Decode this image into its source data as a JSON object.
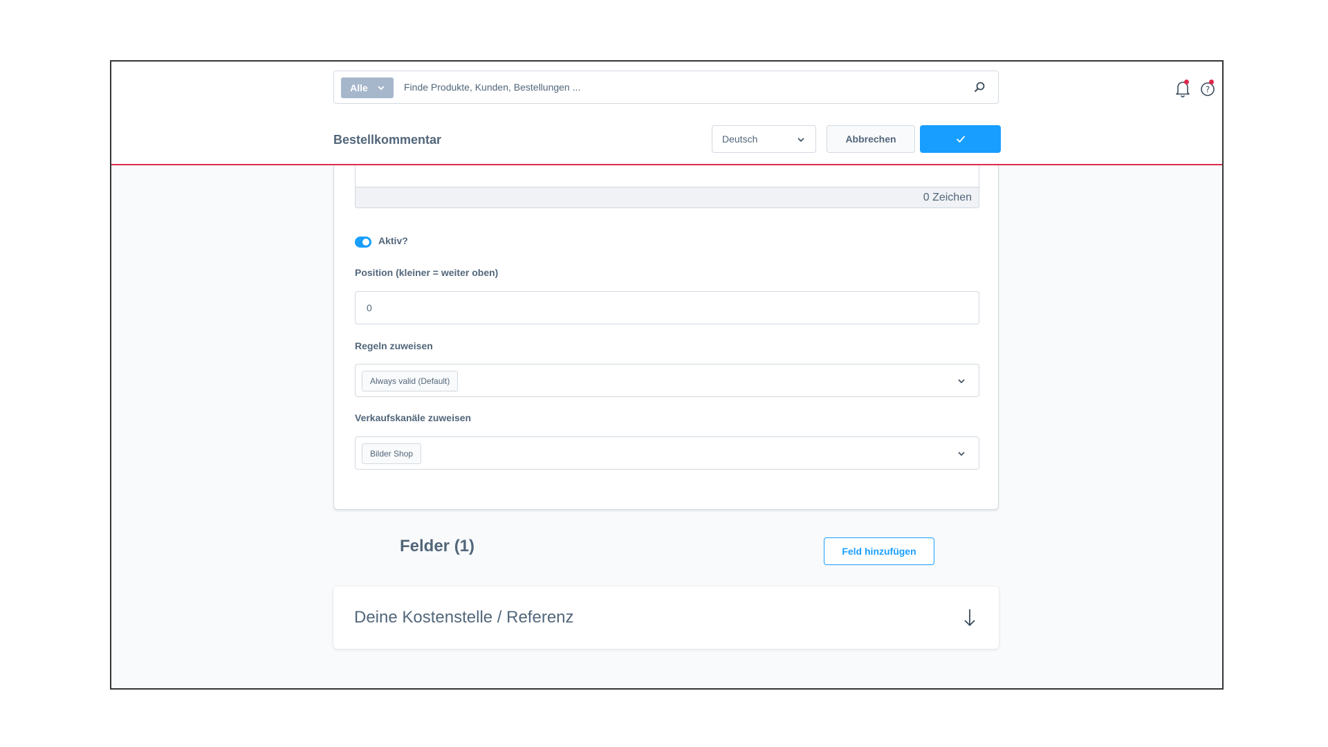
{
  "search": {
    "category": "Alle",
    "placeholder": "Finde Produkte, Kunden, Bestellungen ..."
  },
  "smartbar": {
    "title": "Bestellkommentar",
    "language": "Deutsch",
    "cancel_label": "Abbrechen"
  },
  "form": {
    "char_counter": "0 Zeichen",
    "active_label": "Aktiv?",
    "active": true,
    "position_label": "Position (kleiner = weiter oben)",
    "position_value": "0",
    "rules_label": "Regeln zuweisen",
    "rules_selected": "Always valid (Default)",
    "channels_label": "Verkaufskanäle zuweisen",
    "channels_selected": "Bilder Shop"
  },
  "fields": {
    "heading": "Felder (1)",
    "add_label": "Feld hinzufügen",
    "items": [
      {
        "label": "Deine Kostenstelle / Referenz"
      }
    ]
  },
  "colors": {
    "primary": "#189eff",
    "accent_red": "#de294c",
    "text": "#52667a"
  }
}
